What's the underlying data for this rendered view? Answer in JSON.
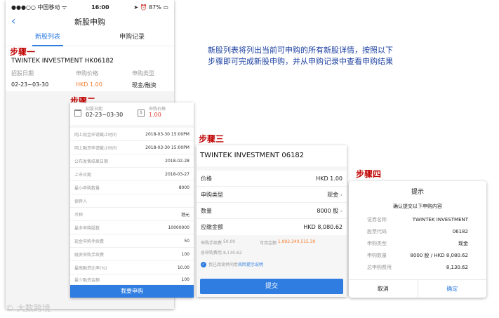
{
  "phone": {
    "status_carrier": "中国移动",
    "status_time": "16:00",
    "status_battery": "87%",
    "nav_title": "新股申购",
    "tab_new": "新股列表",
    "tab_records": "申购记录",
    "stock_title": "TWINTEK INVESTMENT HK06182",
    "col1_label": "招股日期",
    "col2_label": "申购价格",
    "col3_label": "申购类型",
    "col1_value": "02-23~03-30",
    "col2_value": "HKD 1.00",
    "col3_value": "现金/融资"
  },
  "description": "新股列表将列出当前可申购的所有新股详情，按照以下步骤即可完成新股申购，并从申购记录中查看申购结果",
  "steps": {
    "s1": "步骤一",
    "s2": "步骤二",
    "s3": "步骤三",
    "s4": "步骤四"
  },
  "detail": {
    "header_date_label": "招股日期",
    "header_date_value": "02-23~03-30",
    "header_price_label": "申购价格",
    "header_price_value": "1.00",
    "rows": [
      {
        "label": "网上现金申请截止时间",
        "value": "2018-03-30 15:00PM"
      },
      {
        "label": "网上融资申请截止时间",
        "value": "2018-03-30 15:00PM"
      },
      {
        "label": "公布发售结果日期",
        "value": "2018-02-28"
      },
      {
        "label": "上市日期",
        "value": "2018-03-27"
      },
      {
        "label": "最小申购数量",
        "value": "8000"
      },
      {
        "label": "保荐人",
        "value": ""
      },
      {
        "label": "币种",
        "value": "港元"
      },
      {
        "label": "最多申购股数",
        "value": "10000000"
      },
      {
        "label": "现金申购手续费",
        "value": "50"
      },
      {
        "label": "融资申购手续费",
        "value": "100"
      },
      {
        "label": "最高融资比率(%)",
        "value": "10.00"
      },
      {
        "label": "最少融资金额",
        "value": "100"
      }
    ],
    "apply_button": "我要申购"
  },
  "form": {
    "title": "TWINTEK INVESTMENT 06182",
    "price_label": "价格",
    "price_value": "HKD 1.00",
    "type_label": "申购类型",
    "type_value": "现金",
    "qty_label": "数量",
    "qty_value": "8000 股",
    "due_label": "应缴金额",
    "due_value": "HKD 8,080.62",
    "fee_label": "申购手续费",
    "fee_value": "50.00",
    "avail_label": "可用金额",
    "avail_value": "1,992,340,515.39",
    "total_label": "总申购费用",
    "total_value": "8,130.62",
    "agree_text": "我已阅读并同意",
    "agree_link": "风险提示说明",
    "submit_button": "提交"
  },
  "dialog": {
    "title": "提示",
    "subtitle": "确认提交以下申购内容",
    "rows": [
      {
        "label": "证券名称",
        "value": "TWINTEK INVESTMENT"
      },
      {
        "label": "股票代码",
        "value": "06182"
      },
      {
        "label": "申购类型",
        "value": "现金"
      },
      {
        "label": "申购数量",
        "value": "8000 股 / HKD 8,080.62"
      },
      {
        "label": "总申购费用",
        "value": "8,130.62"
      }
    ],
    "cancel": "取消",
    "confirm": "确定"
  },
  "watermark": "大数跨境"
}
